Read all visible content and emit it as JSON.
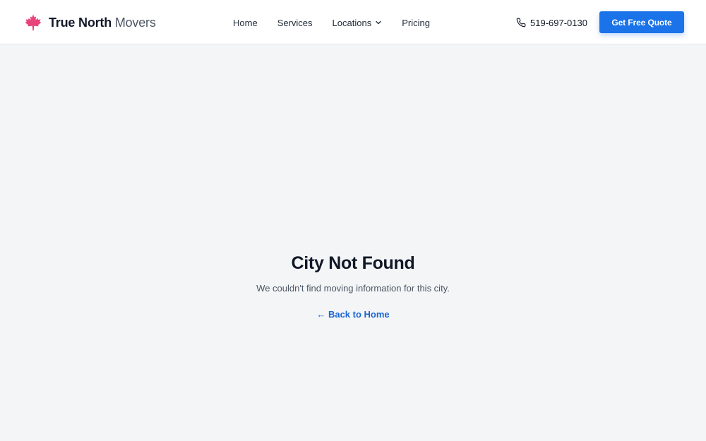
{
  "header": {
    "logo": {
      "strong": "True North",
      "light": "Movers",
      "icon": "maple-leaf-icon",
      "icon_color": "#e8437b"
    },
    "nav": [
      {
        "label": "Home"
      },
      {
        "label": "Services"
      },
      {
        "label": "Locations",
        "icon": "chevron-down-icon"
      },
      {
        "label": "Pricing"
      }
    ],
    "phone": {
      "icon": "phone-icon",
      "number": "519-697-0130"
    },
    "cta_label": "Get Free Quote"
  },
  "main": {
    "title": "City Not Found",
    "subtitle": "We couldn't find moving information for this city.",
    "back_link": "← Back to Home"
  },
  "colors": {
    "accent": "#1a73e8",
    "background": "#f4f5f7",
    "header_background": "#ffffff",
    "brand_leaf": "#e8437b"
  }
}
